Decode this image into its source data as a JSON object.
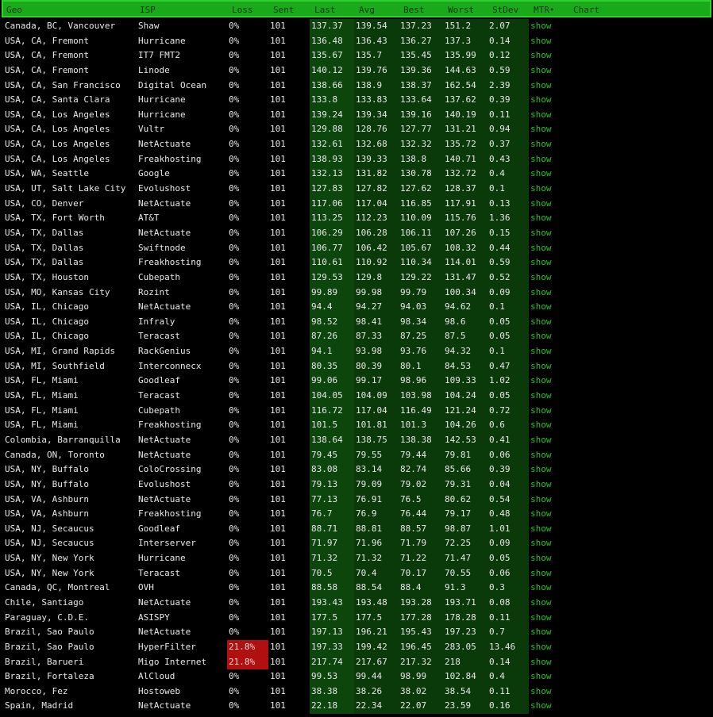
{
  "header": {
    "geo": "Geo",
    "isp": "ISP",
    "loss": "Loss",
    "sent": "Sent",
    "last": "Last",
    "avg": "Avg",
    "best": "Best",
    "worst": "Worst",
    "stdev": "StDev",
    "mtr": "MTR•",
    "chart": "Chart"
  },
  "link_label": "show",
  "colors": {
    "header_bg": "#1aa91a",
    "bar": "#17b317",
    "loss_bad": "#b01010",
    "stats_bg": "#0a3a0a"
  },
  "rows": [
    {
      "geo": "Canada, BC, Vancouver",
      "isp": "Shaw",
      "loss": "0%",
      "sent": "101",
      "last": "137.37",
      "avg": "139.54",
      "best": "137.23",
      "worst": "151.2",
      "stdev": "2.07"
    },
    {
      "geo": "USA, CA, Fremont",
      "isp": "Hurricane",
      "loss": "0%",
      "sent": "101",
      "last": "136.48",
      "avg": "136.43",
      "best": "136.27",
      "worst": "137.3",
      "stdev": "0.14"
    },
    {
      "geo": "USA, CA, Fremont",
      "isp": "IT7 FMT2",
      "loss": "0%",
      "sent": "101",
      "last": "135.67",
      "avg": "135.7",
      "best": "135.45",
      "worst": "135.99",
      "stdev": "0.12"
    },
    {
      "geo": "USA, CA, Fremont",
      "isp": "Linode",
      "loss": "0%",
      "sent": "101",
      "last": "140.12",
      "avg": "139.76",
      "best": "139.36",
      "worst": "144.63",
      "stdev": "0.59"
    },
    {
      "geo": "USA, CA, San Francisco",
      "isp": "Digital Ocean",
      "loss": "0%",
      "sent": "101",
      "last": "138.66",
      "avg": "138.9",
      "best": "138.37",
      "worst": "162.54",
      "stdev": "2.39"
    },
    {
      "geo": "USA, CA, Santa Clara",
      "isp": "Hurricane",
      "loss": "0%",
      "sent": "101",
      "last": "133.8",
      "avg": "133.83",
      "best": "133.64",
      "worst": "137.62",
      "stdev": "0.39"
    },
    {
      "geo": "USA, CA, Los Angeles",
      "isp": "Hurricane",
      "loss": "0%",
      "sent": "101",
      "last": "139.24",
      "avg": "139.34",
      "best": "139.16",
      "worst": "140.19",
      "stdev": "0.11"
    },
    {
      "geo": "USA, CA, Los Angeles",
      "isp": "Vultr",
      "loss": "0%",
      "sent": "101",
      "last": "129.88",
      "avg": "128.76",
      "best": "127.77",
      "worst": "131.21",
      "stdev": "0.94"
    },
    {
      "geo": "USA, CA, Los Angeles",
      "isp": "NetActuate",
      "loss": "0%",
      "sent": "101",
      "last": "132.61",
      "avg": "132.68",
      "best": "132.32",
      "worst": "135.72",
      "stdev": "0.37"
    },
    {
      "geo": "USA, CA, Los Angeles",
      "isp": "Freakhosting",
      "loss": "0%",
      "sent": "101",
      "last": "138.93",
      "avg": "139.33",
      "best": "138.8",
      "worst": "140.71",
      "stdev": "0.43"
    },
    {
      "geo": "USA, WA, Seattle",
      "isp": "Google",
      "loss": "0%",
      "sent": "101",
      "last": "132.13",
      "avg": "131.82",
      "best": "130.78",
      "worst": "132.72",
      "stdev": "0.4"
    },
    {
      "geo": "USA, UT, Salt Lake City",
      "isp": "Evolushost",
      "loss": "0%",
      "sent": "101",
      "last": "127.83",
      "avg": "127.82",
      "best": "127.62",
      "worst": "128.37",
      "stdev": "0.1"
    },
    {
      "geo": "USA, CO, Denver",
      "isp": "NetActuate",
      "loss": "0%",
      "sent": "101",
      "last": "117.06",
      "avg": "117.04",
      "best": "116.85",
      "worst": "117.91",
      "stdev": "0.13"
    },
    {
      "geo": "USA, TX, Fort Worth",
      "isp": "AT&T",
      "loss": "0%",
      "sent": "101",
      "last": "113.25",
      "avg": "112.23",
      "best": "110.09",
      "worst": "115.76",
      "stdev": "1.36"
    },
    {
      "geo": "USA, TX, Dallas",
      "isp": "NetActuate",
      "loss": "0%",
      "sent": "101",
      "last": "106.29",
      "avg": "106.28",
      "best": "106.11",
      "worst": "107.26",
      "stdev": "0.15"
    },
    {
      "geo": "USA, TX, Dallas",
      "isp": "Swiftnode",
      "loss": "0%",
      "sent": "101",
      "last": "106.77",
      "avg": "106.42",
      "best": "105.67",
      "worst": "108.32",
      "stdev": "0.44"
    },
    {
      "geo": "USA, TX, Dallas",
      "isp": "Freakhosting",
      "loss": "0%",
      "sent": "101",
      "last": "110.61",
      "avg": "110.92",
      "best": "110.34",
      "worst": "114.01",
      "stdev": "0.59"
    },
    {
      "geo": "USA, TX, Houston",
      "isp": "Cubepath",
      "loss": "0%",
      "sent": "101",
      "last": "129.53",
      "avg": "129.8",
      "best": "129.22",
      "worst": "131.47",
      "stdev": "0.52"
    },
    {
      "geo": "USA, MO, Kansas City",
      "isp": "Rozint",
      "loss": "0%",
      "sent": "101",
      "last": "99.89",
      "avg": "99.98",
      "best": "99.79",
      "worst": "100.34",
      "stdev": "0.09"
    },
    {
      "geo": "USA, IL, Chicago",
      "isp": "NetActuate",
      "loss": "0%",
      "sent": "101",
      "last": "94.4",
      "avg": "94.27",
      "best": "94.03",
      "worst": "94.62",
      "stdev": "0.1"
    },
    {
      "geo": "USA, IL, Chicago",
      "isp": "Infraly",
      "loss": "0%",
      "sent": "101",
      "last": "98.52",
      "avg": "98.41",
      "best": "98.34",
      "worst": "98.6",
      "stdev": "0.05"
    },
    {
      "geo": "USA, IL, Chicago",
      "isp": "Teracast",
      "loss": "0%",
      "sent": "101",
      "last": "87.26",
      "avg": "87.33",
      "best": "87.25",
      "worst": "87.5",
      "stdev": "0.05"
    },
    {
      "geo": "USA, MI, Grand Rapids",
      "isp": "RackGenius",
      "loss": "0%",
      "sent": "101",
      "last": "94.1",
      "avg": "93.98",
      "best": "93.76",
      "worst": "94.32",
      "stdev": "0.1"
    },
    {
      "geo": "USA, MI, Southfield",
      "isp": "Interconnecx",
      "loss": "0%",
      "sent": "101",
      "last": "80.35",
      "avg": "80.39",
      "best": "80.1",
      "worst": "84.53",
      "stdev": "0.47"
    },
    {
      "geo": "USA, FL, Miami",
      "isp": "Goodleaf",
      "loss": "0%",
      "sent": "101",
      "last": "99.06",
      "avg": "99.17",
      "best": "98.96",
      "worst": "109.33",
      "stdev": "1.02"
    },
    {
      "geo": "USA, FL, Miami",
      "isp": "Teracast",
      "loss": "0%",
      "sent": "101",
      "last": "104.05",
      "avg": "104.09",
      "best": "103.98",
      "worst": "104.24",
      "stdev": "0.05"
    },
    {
      "geo": "USA, FL, Miami",
      "isp": "Cubepath",
      "loss": "0%",
      "sent": "101",
      "last": "116.72",
      "avg": "117.04",
      "best": "116.49",
      "worst": "121.24",
      "stdev": "0.72"
    },
    {
      "geo": "USA, FL, Miami",
      "isp": "Freakhosting",
      "loss": "0%",
      "sent": "101",
      "last": "101.5",
      "avg": "101.81",
      "best": "101.3",
      "worst": "104.26",
      "stdev": "0.6"
    },
    {
      "geo": "Colombia, Barranquilla",
      "isp": "NetActuate",
      "loss": "0%",
      "sent": "101",
      "last": "138.64",
      "avg": "138.75",
      "best": "138.38",
      "worst": "142.53",
      "stdev": "0.41"
    },
    {
      "geo": "Canada, ON, Toronto",
      "isp": "NetActuate",
      "loss": "0%",
      "sent": "101",
      "last": "79.45",
      "avg": "79.55",
      "best": "79.44",
      "worst": "79.81",
      "stdev": "0.06"
    },
    {
      "geo": "USA, NY, Buffalo",
      "isp": "ColoCrossing",
      "loss": "0%",
      "sent": "101",
      "last": "83.08",
      "avg": "83.14",
      "best": "82.74",
      "worst": "85.66",
      "stdev": "0.39"
    },
    {
      "geo": "USA, NY, Buffalo",
      "isp": "Evolushost",
      "loss": "0%",
      "sent": "101",
      "last": "79.13",
      "avg": "79.09",
      "best": "79.02",
      "worst": "79.31",
      "stdev": "0.04"
    },
    {
      "geo": "USA, VA, Ashburn",
      "isp": "NetActuate",
      "loss": "0%",
      "sent": "101",
      "last": "77.13",
      "avg": "76.91",
      "best": "76.5",
      "worst": "80.62",
      "stdev": "0.54"
    },
    {
      "geo": "USA, VA, Ashburn",
      "isp": "Freakhosting",
      "loss": "0%",
      "sent": "101",
      "last": "76.7",
      "avg": "76.9",
      "best": "76.44",
      "worst": "79.17",
      "stdev": "0.48"
    },
    {
      "geo": "USA, NJ, Secaucus",
      "isp": "Goodleaf",
      "loss": "0%",
      "sent": "101",
      "last": "88.71",
      "avg": "88.81",
      "best": "88.57",
      "worst": "98.87",
      "stdev": "1.01"
    },
    {
      "geo": "USA, NJ, Secaucus",
      "isp": "Interserver",
      "loss": "0%",
      "sent": "101",
      "last": "71.97",
      "avg": "71.96",
      "best": "71.79",
      "worst": "72.25",
      "stdev": "0.09"
    },
    {
      "geo": "USA, NY, New York",
      "isp": "Hurricane",
      "loss": "0%",
      "sent": "101",
      "last": "71.32",
      "avg": "71.32",
      "best": "71.22",
      "worst": "71.47",
      "stdev": "0.05"
    },
    {
      "geo": "USA, NY, New York",
      "isp": "Teracast",
      "loss": "0%",
      "sent": "101",
      "last": "70.5",
      "avg": "70.4",
      "best": "70.17",
      "worst": "70.55",
      "stdev": "0.06"
    },
    {
      "geo": "Canada, QC, Montreal",
      "isp": "OVH",
      "loss": "0%",
      "sent": "101",
      "last": "88.58",
      "avg": "88.54",
      "best": "88.4",
      "worst": "91.3",
      "stdev": "0.3"
    },
    {
      "geo": "Chile, Santiago",
      "isp": "NetActuate",
      "loss": "0%",
      "sent": "101",
      "last": "193.43",
      "avg": "193.48",
      "best": "193.28",
      "worst": "193.71",
      "stdev": "0.08"
    },
    {
      "geo": "Paraguay, C.D.E.",
      "isp": "ASISPY",
      "loss": "0%",
      "sent": "101",
      "last": "177.5",
      "avg": "177.5",
      "best": "177.28",
      "worst": "178.28",
      "stdev": "0.11"
    },
    {
      "geo": "Brazil, Sao Paulo",
      "isp": "NetActuate",
      "loss": "0%",
      "sent": "101",
      "last": "197.13",
      "avg": "196.21",
      "best": "195.43",
      "worst": "197.23",
      "stdev": "0.7"
    },
    {
      "geo": "Brazil, Sao Paulo",
      "isp": "HyperFilter",
      "loss": "21.8%",
      "sent": "101",
      "last": "197.33",
      "avg": "199.42",
      "best": "196.45",
      "worst": "283.05",
      "stdev": "13.46",
      "bad": true
    },
    {
      "geo": "Brazil, Barueri",
      "isp": "Migo Internet",
      "loss": "21.8%",
      "sent": "101",
      "last": "217.74",
      "avg": "217.67",
      "best": "217.32",
      "worst": "218",
      "stdev": "0.14",
      "bad": true
    },
    {
      "geo": "Brazil, Fortaleza",
      "isp": "AlCloud",
      "loss": "0%",
      "sent": "101",
      "last": "99.53",
      "avg": "99.44",
      "best": "98.99",
      "worst": "102.84",
      "stdev": "0.4"
    },
    {
      "geo": "Morocco, Fez",
      "isp": "Hostoweb",
      "loss": "0%",
      "sent": "101",
      "last": "38.38",
      "avg": "38.26",
      "best": "38.02",
      "worst": "38.54",
      "stdev": "0.11"
    },
    {
      "geo": "Spain, Madrid",
      "isp": "NetActuate",
      "loss": "0%",
      "sent": "101",
      "last": "22.18",
      "avg": "22.34",
      "best": "22.07",
      "worst": "23.59",
      "stdev": "0.16"
    }
  ]
}
